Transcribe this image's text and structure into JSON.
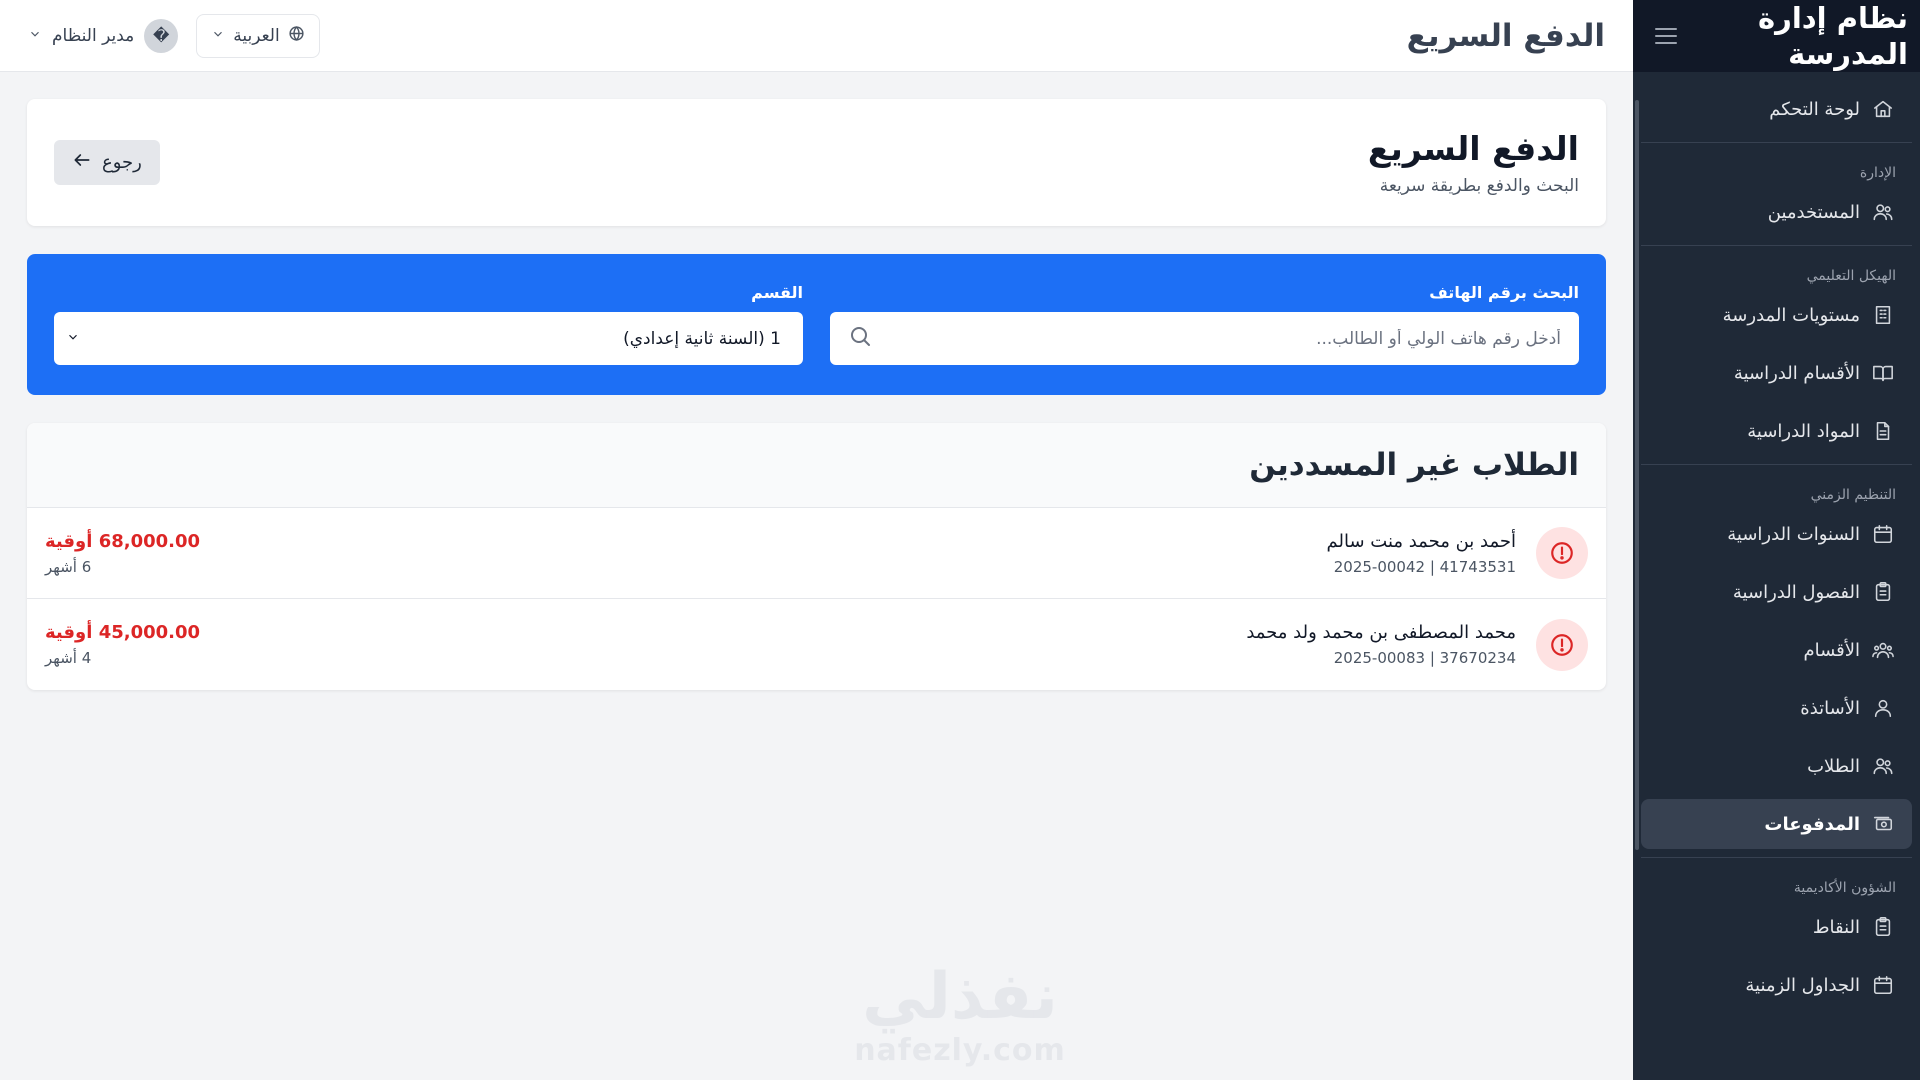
{
  "sidebar": {
    "title": "نظام إدارة المدرسة",
    "items": [
      {
        "label": "لوحة التحكم"
      },
      {
        "label": "المستخدمين"
      },
      {
        "label": "مستويات المدرسة"
      },
      {
        "label": "الأقسام الدراسية"
      },
      {
        "label": "المواد الدراسية"
      },
      {
        "label": "السنوات الدراسية"
      },
      {
        "label": "الفصول الدراسية"
      },
      {
        "label": "الأقسام"
      },
      {
        "label": "الأساتذة"
      },
      {
        "label": "الطلاب"
      },
      {
        "label": "المدفوعات"
      },
      {
        "label": "النقاط"
      },
      {
        "label": "الجداول الزمنية"
      }
    ],
    "sections": {
      "administration": "الإدارة",
      "structure": "الهيكل التعليمي",
      "scheduling": "التنظيم الزمني",
      "academic": "الشؤون الأكاديمية"
    },
    "active_item": "المدفوعات"
  },
  "topbar": {
    "title": "الدفع السريع",
    "language": "العربية",
    "user": "مدير النظام",
    "avatar_glyph": "�"
  },
  "page": {
    "title": "الدفع السريع",
    "subtitle": "البحث والدفع بطريقة سريعة",
    "back_label": "رجوع"
  },
  "search": {
    "phone_label": "البحث برقم الهاتف",
    "phone_placeholder": "أدخل رقم هاتف الولي أو الطالب...",
    "class_label": "القسم",
    "class_value": "1 (السنة ثانية إعدادي)"
  },
  "unpaid": {
    "title": "الطلاب غير المسددين",
    "students": [
      {
        "name": "أحمد بن محمد منت سالم",
        "meta": "41743531 | 2025-00042",
        "amount": "68,000.00 أوقية",
        "months": "6 أشهر"
      },
      {
        "name": "محمد المصطفى بن محمد ولد محمد",
        "meta": "37670234 | 2025-00083",
        "amount": "45,000.00 أوقية",
        "months": "4 أشهر"
      }
    ]
  },
  "watermark": {
    "arabic": "نفذلي",
    "latin": "nafezly.com"
  },
  "colors": {
    "primary": "#1d6ff5",
    "sidebar": "#1f2937",
    "danger": "#dc2626",
    "danger_bg": "#fee2e2"
  }
}
